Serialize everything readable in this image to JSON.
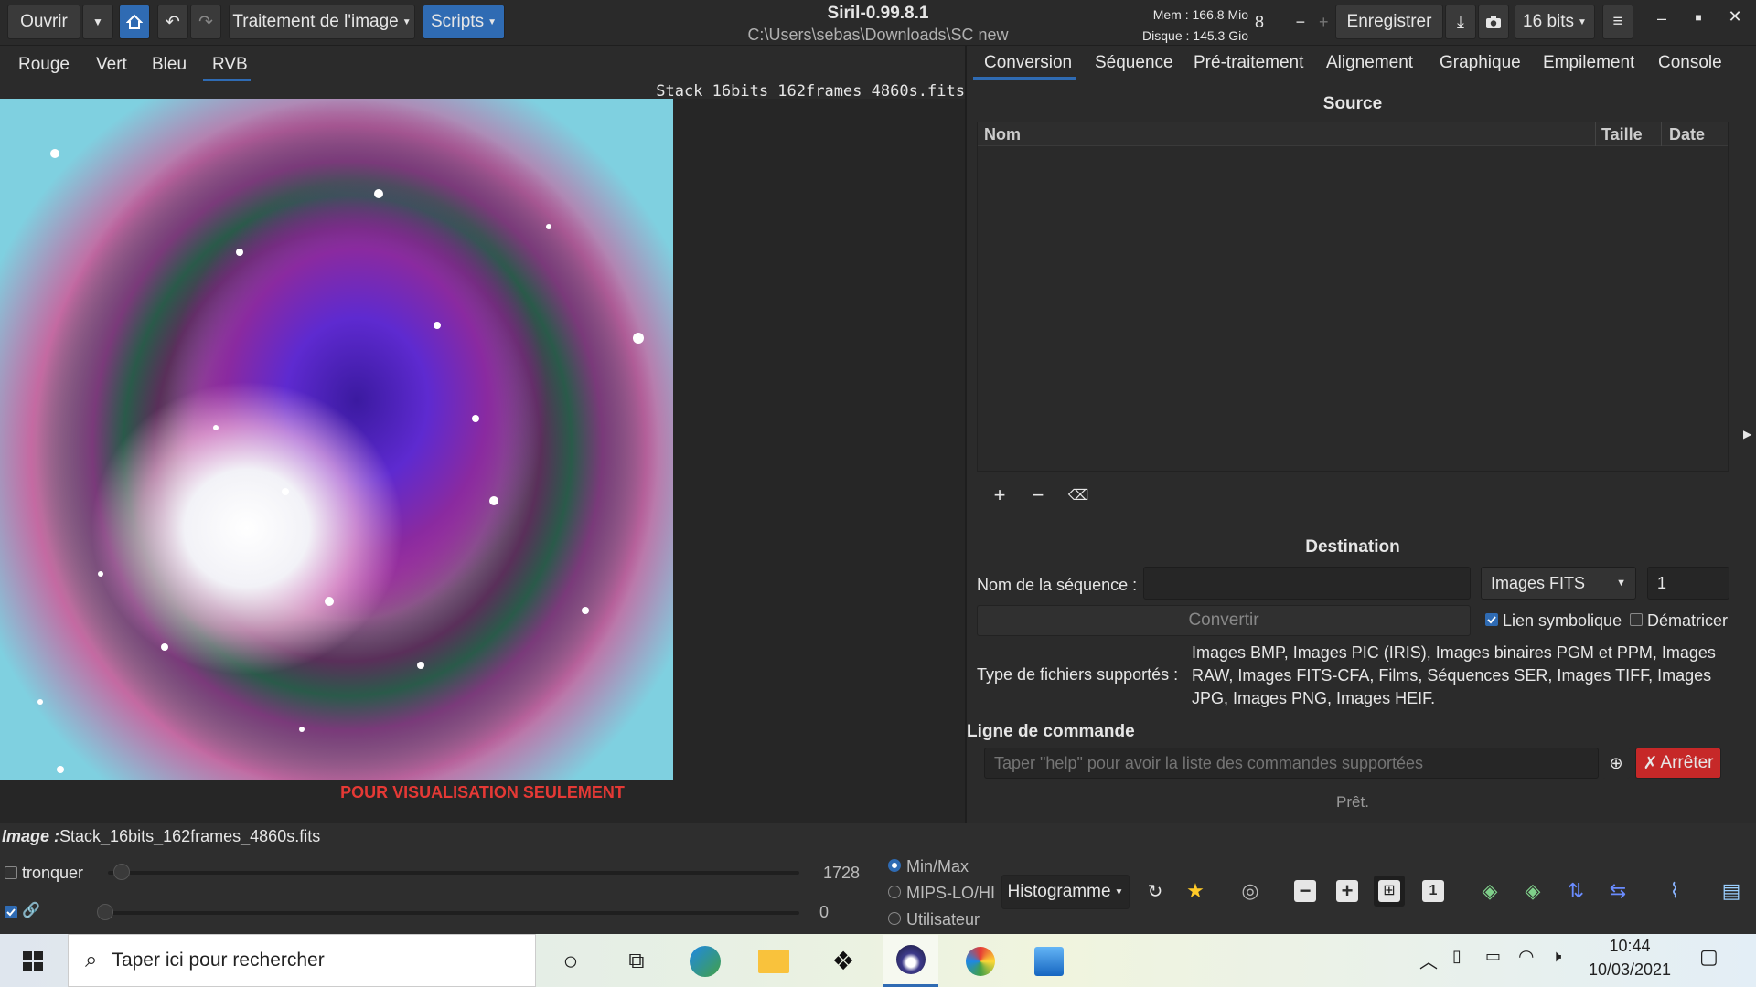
{
  "toolbar": {
    "open_label": "Ouvrir",
    "image_processing_label": "Traitement de l'image",
    "scripts_label": "Scripts",
    "save_label": "Enregistrer",
    "bitdepth_label": "16 bits",
    "threads_value": "8"
  },
  "window": {
    "title": "Siril-0.99.8.1",
    "path": "C:\\Users\\sebas\\Downloads\\SC new",
    "mem": "Mem : 166.8 Mio",
    "disk": "Disque : 145.3 Gio"
  },
  "channels": {
    "red": "Rouge",
    "green": "Vert",
    "blue": "Bleu",
    "rgb": "RVB"
  },
  "viewer": {
    "filename": "Stack_16bits_162frames_4860s.fits",
    "watermark": "POUR VISUALISATION SEULEMENT"
  },
  "right_tabs": [
    "Conversion",
    "Séquence",
    "Pré-traitement",
    "Alignement",
    "Graphique",
    "Empilement",
    "Console"
  ],
  "conversion": {
    "source_title": "Source",
    "col_name": "Nom",
    "col_size": "Taille",
    "col_date": "Date",
    "destination_title": "Destination",
    "seq_name_label": "Nom de la séquence :",
    "seq_name_value": "",
    "format_value": "Images FITS",
    "start_index": "1",
    "convert_label": "Convertir",
    "symlink_label": "Lien symbolique",
    "debayer_label": "Dématricer",
    "supported_label": "Type de fichiers supportés :",
    "supported_text": "Images BMP, Images PIC (IRIS), Images binaires PGM et PPM, Images RAW, Images FITS-CFA, Films, Séquences SER, Images TIFF, Images JPG, Images PNG, Images HEIF."
  },
  "command": {
    "title": "Ligne de commande",
    "placeholder": "Taper \"help\" pour avoir la liste des commandes supportées",
    "stop_label": "Arrêter",
    "status": "Prêt."
  },
  "bottom": {
    "image_label": "Image :",
    "image_name": "Stack_16bits_162frames_4860s.fits",
    "clip_label": "tronquer",
    "high_value": "1728",
    "low_value": "0",
    "mode_minmax": "Min/Max",
    "mode_mips": "MIPS-LO/HI",
    "mode_user": "Utilisateur",
    "display_mode": "Histogramme"
  },
  "taskbar": {
    "search_placeholder": "Taper ici pour rechercher",
    "time": "10:44",
    "date": "10/03/2021"
  },
  "colors": {
    "accent": "#2f6bb3",
    "stop": "#c62828",
    "watermark": "#e53935"
  }
}
